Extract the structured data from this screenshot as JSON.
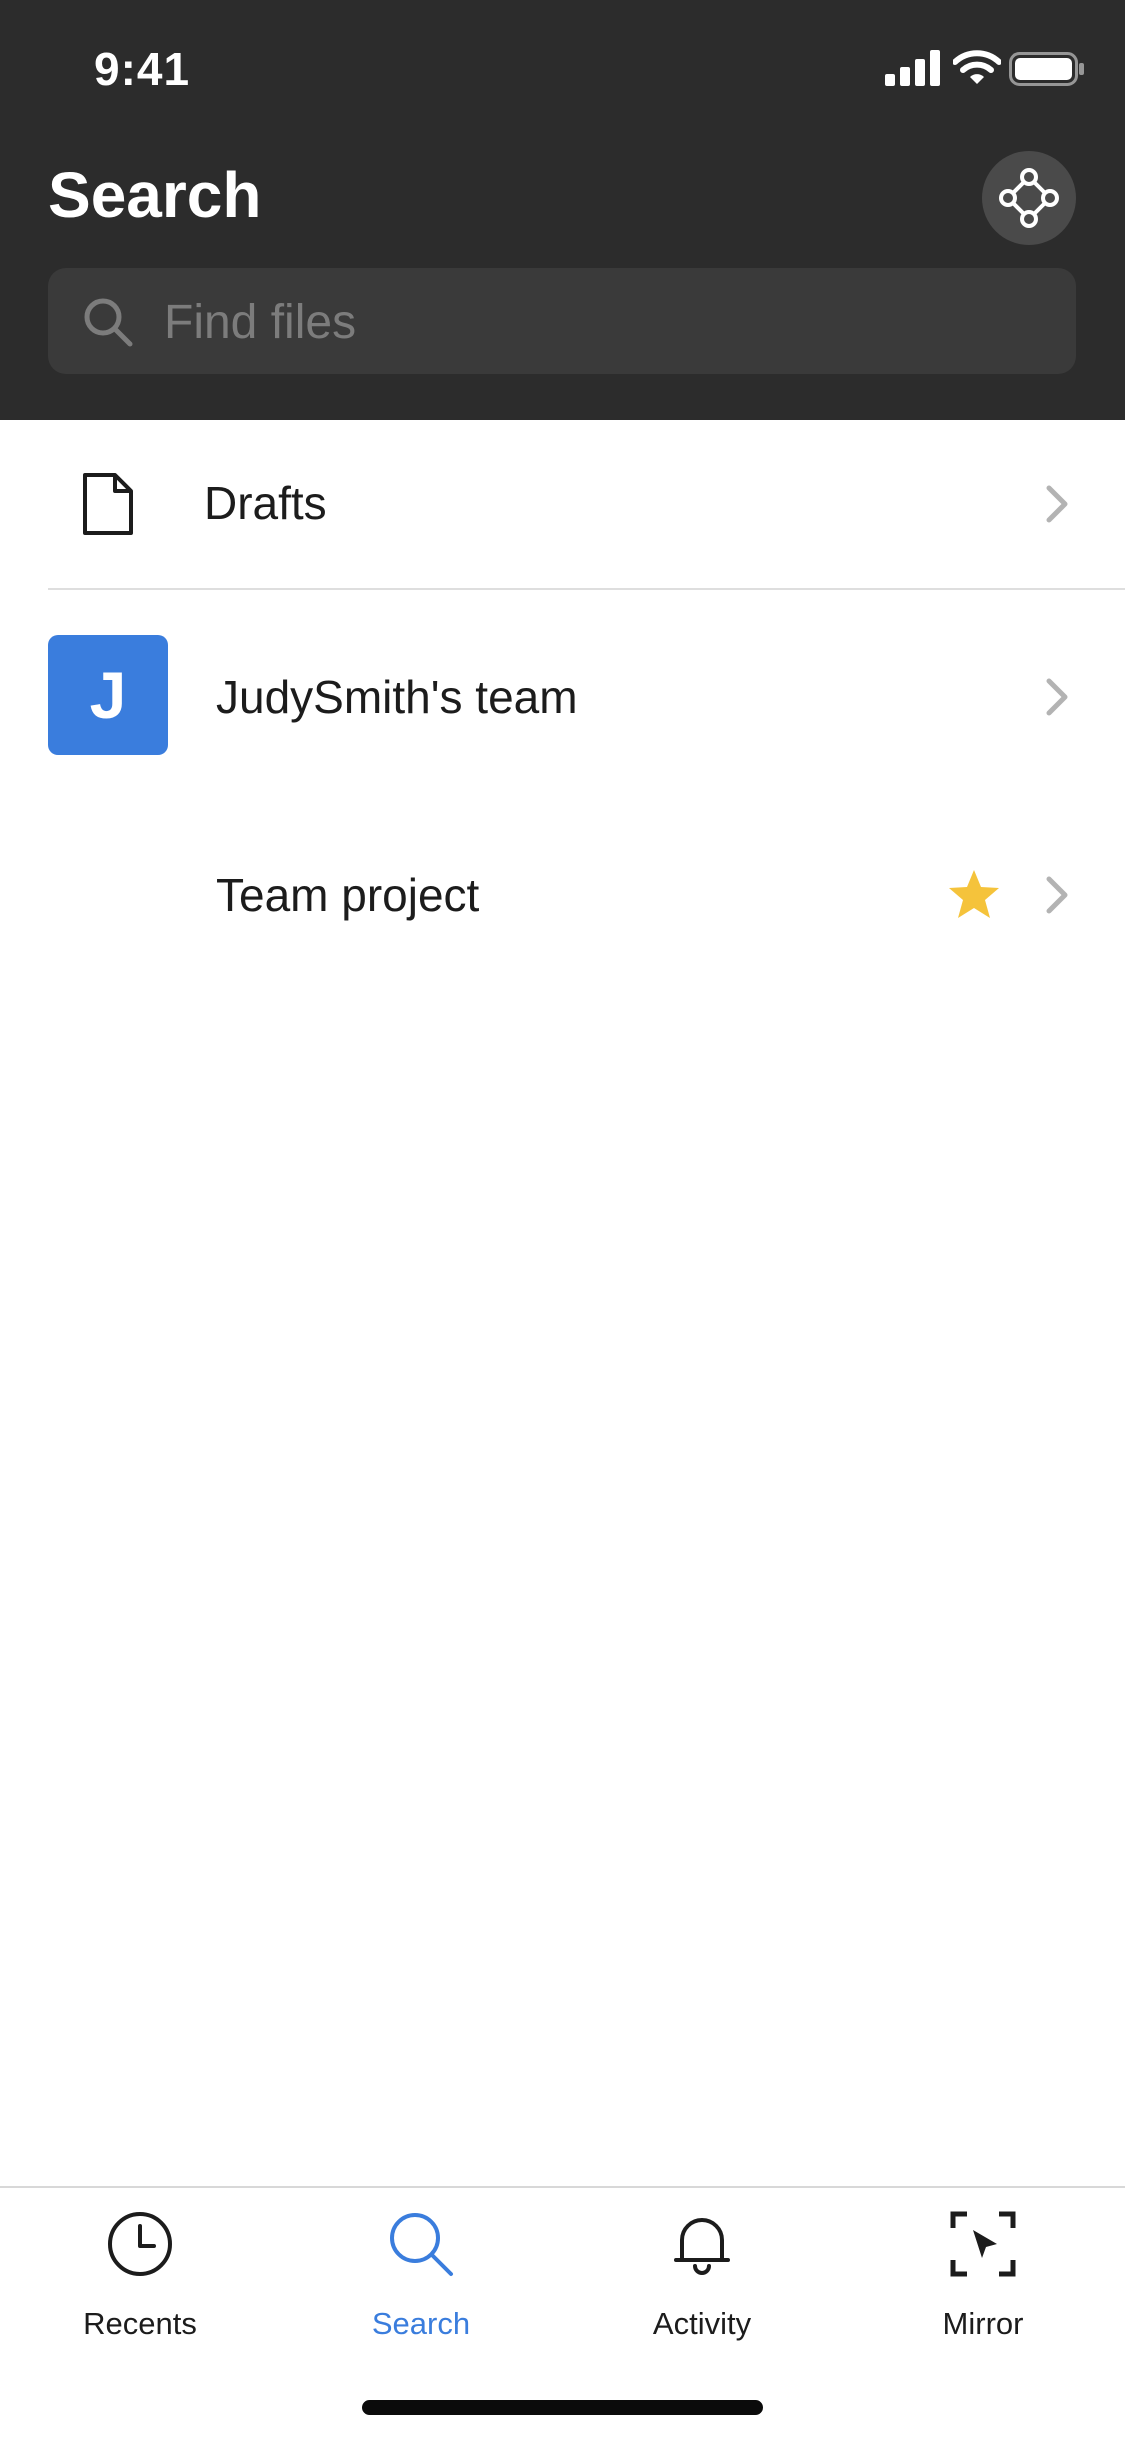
{
  "status_bar": {
    "time": "9:41",
    "icons": [
      "signal-icon",
      "wifi-icon",
      "battery-icon"
    ]
  },
  "header": {
    "title": "Search",
    "plugin_icon": "plugin-icon"
  },
  "search": {
    "placeholder": "Find files",
    "value": "",
    "icon": "search-icon"
  },
  "list": {
    "drafts": {
      "label": "Drafts",
      "icon": "file-icon"
    },
    "team": {
      "label": "JudySmith's team",
      "avatar_letter": "J",
      "avatar_color": "#3a7ddd"
    },
    "project": {
      "label": "Team project",
      "starred": true,
      "star_color": "#f5c33b"
    }
  },
  "tabbar": {
    "tabs": [
      {
        "label": "Recents",
        "icon": "clock-icon",
        "active": false
      },
      {
        "label": "Search",
        "icon": "search-icon",
        "active": true
      },
      {
        "label": "Activity",
        "icon": "bell-icon",
        "active": false
      },
      {
        "label": "Mirror",
        "icon": "mirror-icon",
        "active": false
      }
    ],
    "active_color": "#3a7ddd"
  }
}
